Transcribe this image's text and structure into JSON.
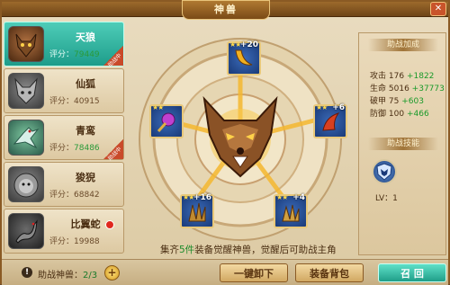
{
  "window": {
    "title": "神兽",
    "close_label": "✕"
  },
  "beasts": [
    {
      "name": "天狼",
      "score_label": "评分：",
      "score": "79449",
      "selected": true,
      "badge": "助战中"
    },
    {
      "name": "仙狐",
      "score_label": "评分：",
      "score": "40915",
      "selected": false
    },
    {
      "name": "青鸾",
      "score_label": "评分：",
      "score": "78486",
      "selected": false,
      "badge": "助战中"
    },
    {
      "name": "狻猊",
      "score_label": "评分：",
      "score": "68842",
      "selected": false
    },
    {
      "name": "比翼蛇",
      "score_label": "评分：",
      "score": "19988",
      "selected": false,
      "red_dot": true
    }
  ],
  "equipment": {
    "slots": [
      {
        "name": "horn",
        "stars": "★★",
        "level": "+20",
        "icon": "horn-icon"
      },
      {
        "name": "orb",
        "stars": "★★",
        "level": "",
        "icon": "orb-icon"
      },
      {
        "name": "horn-red",
        "stars": "★★",
        "level": "+6",
        "icon": "red-horn-icon"
      },
      {
        "name": "claw-left",
        "stars": "★★",
        "level": "+16",
        "icon": "claw-icon"
      },
      {
        "name": "claw-right",
        "stars": "★★",
        "level": "+4",
        "icon": "claw-icon"
      }
    ],
    "hint_prefix": "集齐",
    "hint_count": "5件",
    "hint_suffix": "装备觉醒神兽，觉醒后可助战主角"
  },
  "attributes": {
    "title": "助战加成",
    "stats": [
      {
        "label": "攻击",
        "value": "176",
        "inc": "+1822"
      },
      {
        "label": "生命",
        "value": "5016",
        "inc": "+37773"
      },
      {
        "label": "破甲",
        "value": "75",
        "inc": "+603"
      },
      {
        "label": "防御",
        "value": "100",
        "inc": "+466"
      }
    ]
  },
  "skill": {
    "title": "助战技能",
    "icon": "wolf-shield-icon",
    "level": "LV：1"
  },
  "bottom": {
    "fight_label": "助战神兽：",
    "fight_count": "2/3",
    "plus": "+",
    "unequip_all": "一键卸下",
    "bag": "装备背包",
    "summon": "召 回"
  },
  "colors": {
    "selected_teal": "#1e9c8a",
    "gain_green": "#1a9a2a",
    "frame_brown": "#8a5a24"
  }
}
